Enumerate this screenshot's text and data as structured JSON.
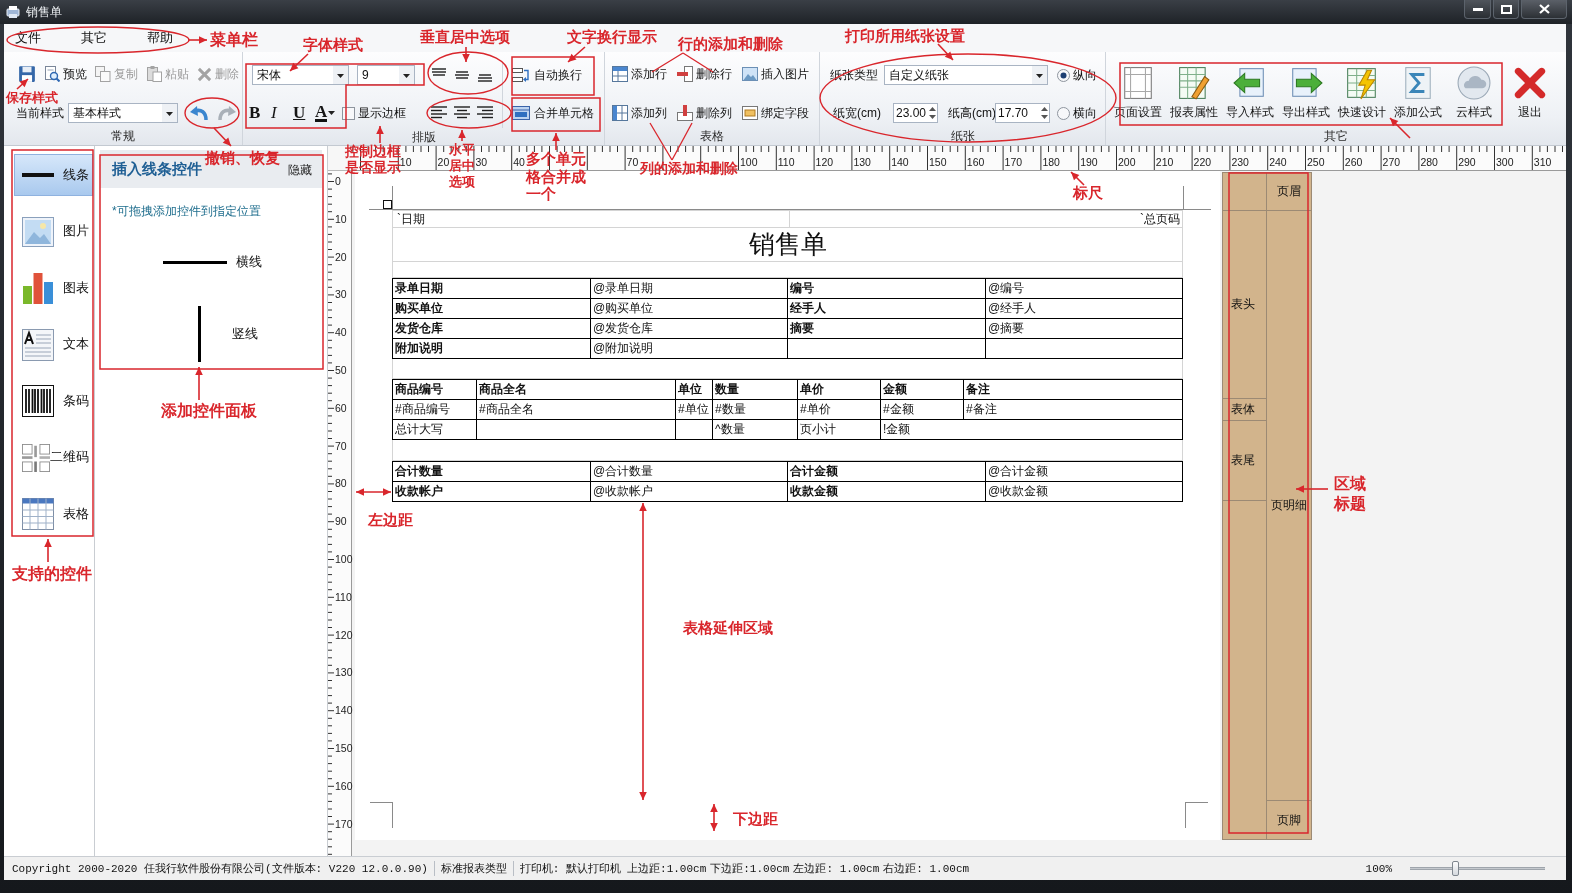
{
  "window": {
    "title": "销售单",
    "controls": [
      {
        "kind": "minimize"
      },
      {
        "kind": "maximize"
      },
      {
        "kind": "close"
      }
    ]
  },
  "menu": [
    {
      "label": "文件"
    },
    {
      "label": "其它"
    },
    {
      "label": "帮助"
    }
  ],
  "ribbon": {
    "general": {
      "label": "常规",
      "actions": [
        {
          "kind": "save",
          "disabled": false
        },
        {
          "kind": "preview",
          "label": "预览",
          "disabled": false
        },
        {
          "kind": "copy",
          "label": "复制",
          "disabled": true
        },
        {
          "kind": "paste",
          "label": "粘贴",
          "disabled": true
        },
        {
          "kind": "delete",
          "label": "删除",
          "disabled": true
        }
      ],
      "style_label": "当前样式",
      "style_value": "基本样式",
      "history": [
        {
          "kind": "undo",
          "disabled": false
        },
        {
          "kind": "redo",
          "disabled": true
        }
      ]
    },
    "layout": {
      "label": "排版",
      "font": "宋体",
      "size": "9",
      "format": [
        {
          "kind": "bold",
          "label": "B"
        },
        {
          "kind": "italic",
          "label": "I"
        },
        {
          "kind": "underline",
          "label": "U"
        },
        {
          "kind": "color",
          "label": "A"
        }
      ],
      "border_toggle": {
        "label": "显示边框",
        "checked": false
      },
      "valign": [
        {
          "kind": "top"
        },
        {
          "kind": "middle"
        },
        {
          "kind": "bottom"
        }
      ],
      "halign": [
        {
          "kind": "left"
        },
        {
          "kind": "center"
        },
        {
          "kind": "right"
        }
      ],
      "wrap": {
        "label": "自动换行"
      },
      "merge": {
        "label": "合并单元格"
      }
    },
    "table": {
      "label": "表格",
      "actions": [
        {
          "kind": "add-row",
          "label": "添加行"
        },
        {
          "kind": "delete-row",
          "label": "删除行"
        },
        {
          "kind": "insert-image",
          "label": "插入图片"
        },
        {
          "kind": "add-column",
          "label": "添加列"
        },
        {
          "kind": "delete-column",
          "label": "删除列"
        },
        {
          "kind": "bind-field",
          "label": "绑定字段"
        }
      ]
    },
    "paper": {
      "label": "纸张",
      "type_label": "纸张类型",
      "type_value": "自定义纸张",
      "width_label": "纸宽(cm)",
      "width_value": "23.00",
      "height_label": "纸高(cm)",
      "height_value": "17.70",
      "orientations": [
        {
          "label": "纵向",
          "selected": true
        },
        {
          "label": "横向",
          "selected": false
        }
      ]
    },
    "other": {
      "label": "其它",
      "actions": [
        {
          "kind": "page-setup",
          "label": "页面设置"
        },
        {
          "kind": "report-properties",
          "label": "报表属性"
        },
        {
          "kind": "import",
          "label": "导入样式"
        },
        {
          "kind": "export",
          "label": "导出样式"
        },
        {
          "kind": "quick-design",
          "label": "快速设计"
        },
        {
          "kind": "formula",
          "label": "添加公式"
        },
        {
          "kind": "cloud",
          "label": "云样式"
        },
        {
          "kind": "exit",
          "label": "退出"
        }
      ]
    }
  },
  "controls": [
    {
      "kind": "line",
      "label": "线条",
      "selected": true
    },
    {
      "kind": "image",
      "label": "图片",
      "selected": false
    },
    {
      "kind": "chart",
      "label": "图表",
      "selected": false
    },
    {
      "kind": "text",
      "label": "文本",
      "selected": false
    },
    {
      "kind": "barcode",
      "label": "条码",
      "selected": false
    },
    {
      "kind": "qrcode",
      "label": "二维码",
      "selected": false
    },
    {
      "kind": "table",
      "label": "表格",
      "selected": false
    }
  ],
  "panel": {
    "title": "插入线条控件",
    "hide": "隐藏",
    "hint": "*可拖拽添加控件到指定位置",
    "items": [
      {
        "kind": "horizontal",
        "label": "横线"
      },
      {
        "kind": "vertical",
        "label": "竖线"
      }
    ]
  },
  "ruler": {
    "horizontal": [
      "10",
      "20",
      "30",
      "40",
      "70",
      "100",
      "110",
      "120",
      "130",
      "140",
      "150",
      "160",
      "170",
      "180",
      "190",
      "200",
      "210",
      "220",
      "230",
      "240",
      "250",
      "260",
      "270",
      "280",
      "290",
      "300",
      "310"
    ],
    "vertical": [
      "0",
      "10",
      "20",
      "30",
      "40",
      "50",
      "60",
      "70",
      "80",
      "90",
      "100",
      "110",
      "120",
      "130",
      "140",
      "150",
      "160",
      "170"
    ]
  },
  "report": {
    "page_header": [
      "`日期",
      "`总页码"
    ],
    "title": "销售单",
    "info_rows": [
      [
        {
          "kind": "label",
          "text": "录单日期"
        },
        {
          "kind": "value",
          "text": "@录单日期"
        },
        {
          "kind": "label",
          "text": "编号"
        },
        {
          "kind": "value",
          "text": "@编号"
        }
      ],
      [
        {
          "kind": "label",
          "text": "购买单位"
        },
        {
          "kind": "value",
          "text": "@购买单位"
        },
        {
          "kind": "label",
          "text": "经手人"
        },
        {
          "kind": "value",
          "text": "@经手人"
        }
      ],
      [
        {
          "kind": "label",
          "text": "发货仓库"
        },
        {
          "kind": "value",
          "text": "@发货仓库"
        },
        {
          "kind": "label",
          "text": "摘要"
        },
        {
          "kind": "value",
          "text": "@摘要"
        }
      ],
      [
        {
          "kind": "label",
          "text": "附加说明"
        },
        {
          "kind": "value",
          "text": "@附加说明"
        },
        {
          "kind": "blank"
        },
        {
          "kind": "blank"
        }
      ]
    ],
    "detail_rows": [
      [
        {
          "kind": "label",
          "text": "商品编号"
        },
        {
          "kind": "label",
          "text": "商品全名"
        },
        {
          "kind": "label",
          "text": "单位"
        },
        {
          "kind": "label",
          "text": "数量"
        },
        {
          "kind": "label",
          "text": "单价"
        },
        {
          "kind": "label",
          "text": "金额"
        },
        {
          "kind": "label",
          "text": "备注"
        }
      ],
      [
        {
          "kind": "value",
          "text": "#商品编号"
        },
        {
          "kind": "value",
          "text": "#商品全名"
        },
        {
          "kind": "value",
          "text": "#单位"
        },
        {
          "kind": "value",
          "text": "#数量"
        },
        {
          "kind": "value",
          "text": "#单价"
        },
        {
          "kind": "value",
          "text": "#金额"
        },
        {
          "kind": "value",
          "text": "#备注"
        }
      ],
      [
        {
          "kind": "value",
          "text": "总计大写"
        },
        {
          "kind": "blank"
        },
        {
          "kind": "blank"
        },
        {
          "kind": "value",
          "text": "^数量"
        },
        {
          "kind": "value",
          "text": "页小计"
        },
        {
          "kind": "wide-value",
          "text": "!金额"
        }
      ]
    ],
    "total_rows": [
      [
        {
          "kind": "label",
          "text": "合计数量"
        },
        {
          "kind": "value",
          "text": "@合计数量"
        },
        {
          "kind": "label",
          "text": "合计金额"
        },
        {
          "kind": "value",
          "text": "@合计金额"
        }
      ],
      [
        {
          "kind": "label",
          "text": "收款帐户"
        },
        {
          "kind": "value",
          "text": "@收款帐户"
        },
        {
          "kind": "label",
          "text": "收款金额"
        },
        {
          "kind": "value",
          "text": "@收款金额"
        }
      ]
    ]
  },
  "regions": {
    "table": [
      {
        "label": "表头"
      },
      {
        "label": "表体"
      },
      {
        "label": "表尾"
      }
    ],
    "page": [
      {
        "label": "页眉"
      },
      {
        "label": "页明细"
      },
      {
        "label": "页脚"
      }
    ]
  },
  "status_bar": {
    "copyright": "Copyright 2000-2020 任我行软件股份有限公司(文件版本: V220 12.0.0.90)",
    "report_type": "标准报表类型",
    "printer": "打印机: 默认打印机",
    "margins": [
      "上边距:1.00cm",
      "下边距:1.00cm",
      "左边距: 1.00cm",
      "右边距: 1.00cm"
    ],
    "zoom": {
      "reading": "100%",
      "level": 0.33
    }
  },
  "annotations": [
    "菜单栏",
    "保存样式",
    "字体样式",
    "垂直居中选项",
    "文字换行显示",
    "行的添加和删除",
    "打印所用纸张设置",
    "撤销、恢复",
    "控制边框是否显示",
    "水平居中选项",
    "多个单元格合并成一个",
    "列的添加和删除",
    "标尺",
    "添加控件面板",
    "支持的控件",
    "左边距",
    "表格延伸区域",
    "下边距",
    "区域标题"
  ]
}
